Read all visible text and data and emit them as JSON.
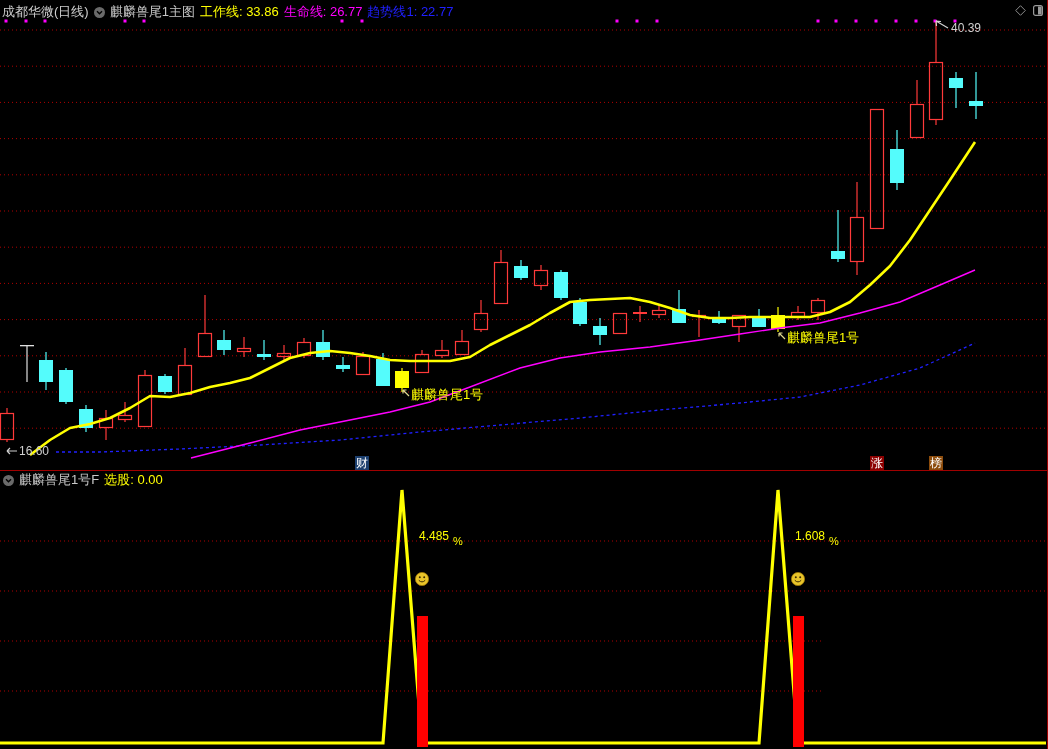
{
  "header": {
    "symbol": "成都华微(日线)",
    "indicator": "麒麟兽尾1主图",
    "legend": [
      {
        "text": "工作线: 33.86",
        "color": "#ffff00"
      },
      {
        "text": "生命线: 26.77",
        "color": "#ff00ff"
      },
      {
        "text": "趋势线1: 22.77",
        "color": "#2020ff"
      }
    ]
  },
  "main_chart": {
    "high_label": "40.39",
    "low_label": "16.60",
    "signals": [
      {
        "text": "麒麟兽尾1号"
      },
      {
        "text": "麒麟兽尾1号"
      }
    ],
    "tags": [
      {
        "text": "财",
        "color": "#1c3f6e"
      },
      {
        "text": "涨",
        "color": "#8c0000"
      },
      {
        "text": "榜",
        "color": "#8c4c0c"
      }
    ]
  },
  "sub_panel": {
    "indicator": "麒麟兽尾1号F",
    "readout": "选股: 0.00",
    "peaks": [
      {
        "percent": "4.485",
        "unit": "%"
      },
      {
        "percent": "1.608",
        "unit": "%"
      }
    ]
  }
}
